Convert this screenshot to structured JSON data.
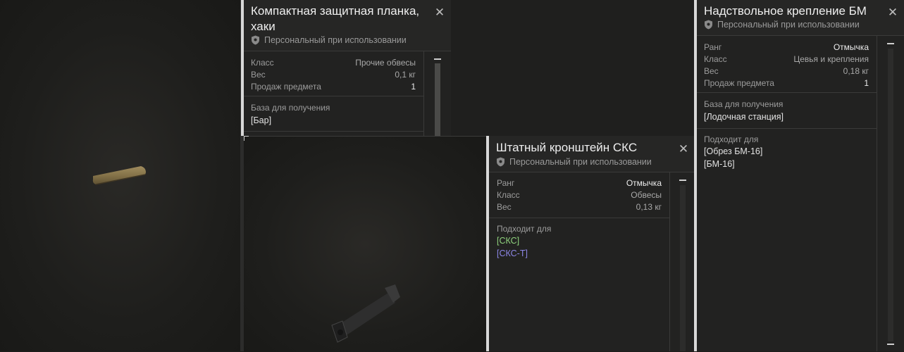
{
  "tooltips": [
    {
      "title": "Компактная защитная планка,",
      "title2": "хаки",
      "personal": "Персональный при использовании",
      "rows": [
        {
          "label": "Класс",
          "value": "Прочие обвесы"
        },
        {
          "label": "Вес",
          "value": "0,1 кг"
        },
        {
          "label": "Продаж предмета",
          "value": "1"
        }
      ],
      "base_label": "База для получения",
      "base_value": "[Бар]"
    },
    {
      "title": "Штатный кронштейн СКС",
      "personal": "Персональный при использовании",
      "rows": [
        {
          "label": "Ранг",
          "value": "Отмычка"
        },
        {
          "label": "Класс",
          "value": "Обвесы"
        },
        {
          "label": "Вес",
          "value": "0,13 кг"
        }
      ],
      "fits_label": "Подходит для",
      "fits": [
        {
          "name": "[СКС]",
          "color": "#8fd27d"
        },
        {
          "name": "[СКС-Т]",
          "color": "#8c86e6"
        }
      ]
    },
    {
      "title": "Надствольное крепление БМ",
      "personal": "Персональный при использовании",
      "rows": [
        {
          "label": "Ранг",
          "value": "Отмычка"
        },
        {
          "label": "Класс",
          "value": "Цевья и крепления"
        },
        {
          "label": "Вес",
          "value": "0,18 кг"
        },
        {
          "label": "Продаж предмета",
          "value": "1"
        }
      ],
      "base_label": "База для получения",
      "base_value": "[Лодочная станция]",
      "fits_label": "Подходит для",
      "fits": [
        {
          "name": "[Обрез БМ-16]",
          "color": "#e2e2e2"
        },
        {
          "name": "[БМ-16]",
          "color": "#e2e2e2"
        }
      ]
    }
  ],
  "close_glyph": "✕",
  "icons": {
    "personal": "shield-icon",
    "close": "close-icon"
  }
}
